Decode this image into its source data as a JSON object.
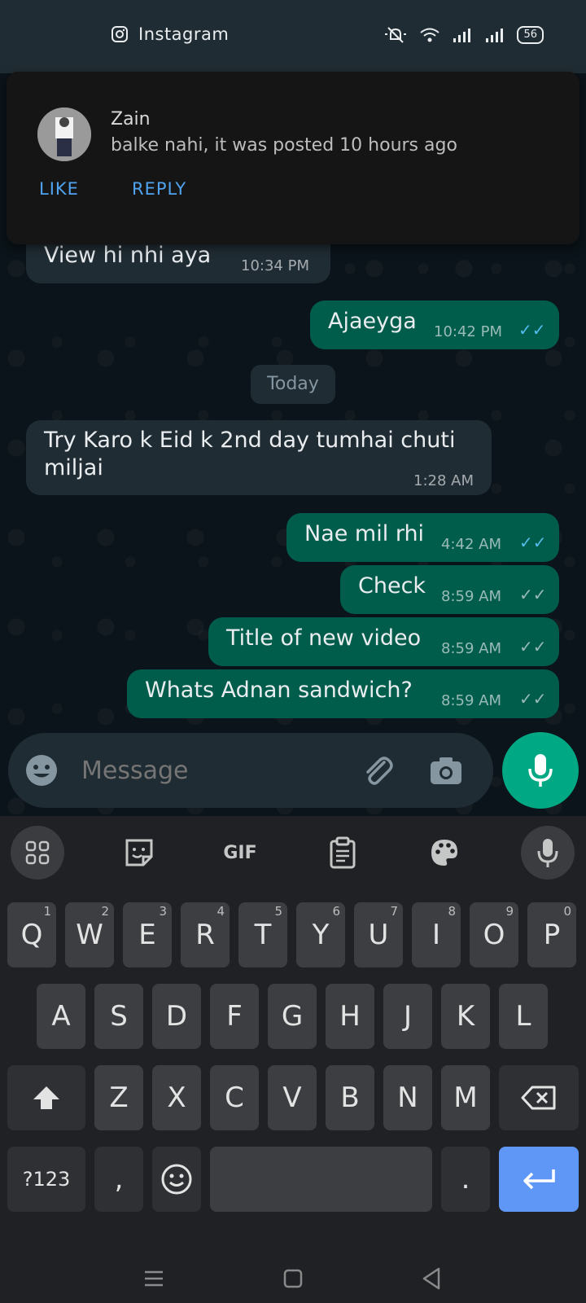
{
  "status_bar": {
    "app_label": "Instagram",
    "battery": "56"
  },
  "notification": {
    "sender": "Zain",
    "text": "balke nahi, it was posted 10 hours ago",
    "actions": [
      "LIKE",
      "REPLY"
    ]
  },
  "messages": [
    {
      "text": "View hi nhi aya",
      "time": "10:34 PM",
      "direction": "in"
    },
    {
      "text": "Ajaeyga",
      "time": "10:42 PM",
      "direction": "out",
      "status": "read"
    },
    {
      "text": "Try Karo k Eid k 2nd day tumhai chuti miljai",
      "time": "1:28 AM",
      "direction": "in"
    },
    {
      "text": "Nae mil rhi",
      "time": "4:42 AM",
      "direction": "out",
      "status": "read"
    },
    {
      "text": "Check",
      "time": "8:59 AM",
      "direction": "out",
      "status": "delivered"
    },
    {
      "text": "Title of new video",
      "time": "8:59 AM",
      "direction": "out",
      "status": "delivered"
    },
    {
      "text": "Whats Adnan sandwich?",
      "time": "8:59 AM",
      "direction": "out",
      "status": "delivered"
    }
  ],
  "day_divider": "Today",
  "composer": {
    "placeholder": "Message"
  },
  "keyboard": {
    "toolbar": {
      "gif_label": "GIF"
    },
    "row1": [
      {
        "k": "Q",
        "h": "1"
      },
      {
        "k": "W",
        "h": "2"
      },
      {
        "k": "E",
        "h": "3"
      },
      {
        "k": "R",
        "h": "4"
      },
      {
        "k": "T",
        "h": "5"
      },
      {
        "k": "Y",
        "h": "6"
      },
      {
        "k": "U",
        "h": "7"
      },
      {
        "k": "I",
        "h": "8"
      },
      {
        "k": "O",
        "h": "9"
      },
      {
        "k": "P",
        "h": "0"
      }
    ],
    "row2": [
      "A",
      "S",
      "D",
      "F",
      "G",
      "H",
      "J",
      "K",
      "L"
    ],
    "row3": [
      "Z",
      "X",
      "C",
      "V",
      "B",
      "N",
      "M"
    ],
    "symbols_key": "?123",
    "comma_key": ",",
    "period_key": "."
  },
  "colors": {
    "outgoing": "#005c4b",
    "incoming": "#202c33",
    "accent": "#00a884",
    "read_ticks": "#53bdeb"
  }
}
